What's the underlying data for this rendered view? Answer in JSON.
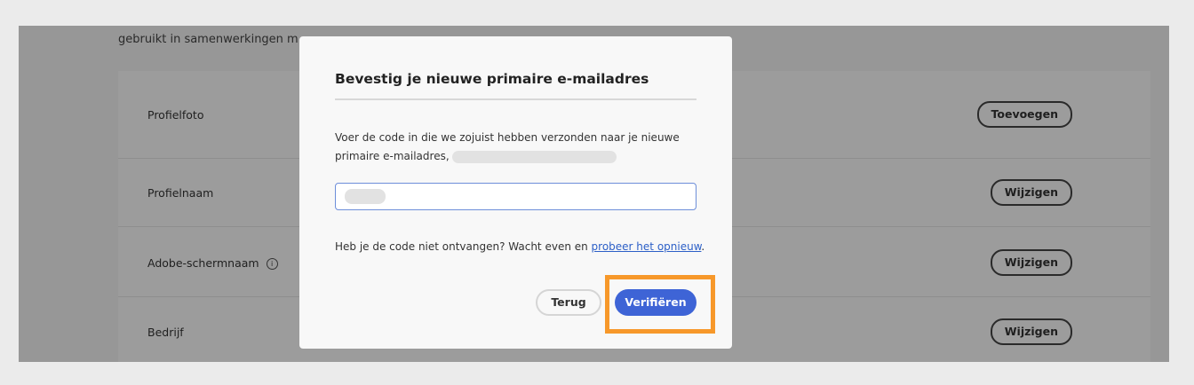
{
  "background": {
    "intro_text": "gebruikt in samenwerkingen m",
    "rows": [
      {
        "label": "Profielfoto",
        "button": "Toevoegen"
      },
      {
        "label": "Profielnaam",
        "button": "Wijzigen"
      },
      {
        "label": "Adobe-schermnaam",
        "button": "Wijzigen",
        "info": "i"
      },
      {
        "label": "Bedrijf",
        "button": "Wijzigen"
      }
    ]
  },
  "modal": {
    "title": "Bevestig je nieuwe primaire e-mailadres",
    "description_line1": "Voer de code in die we zojuist hebben verzonden naar je nieuwe",
    "description_line2": "primaire e-mailadres,",
    "resend_text": "Heb je de code niet ontvangen? Wacht even en ",
    "resend_link": "probeer het opnieuw",
    "resend_end": ".",
    "back_label": "Terug",
    "verify_label": "Verifiëren"
  },
  "colors": {
    "primary": "#3e64d6",
    "highlight": "#f7982a"
  }
}
